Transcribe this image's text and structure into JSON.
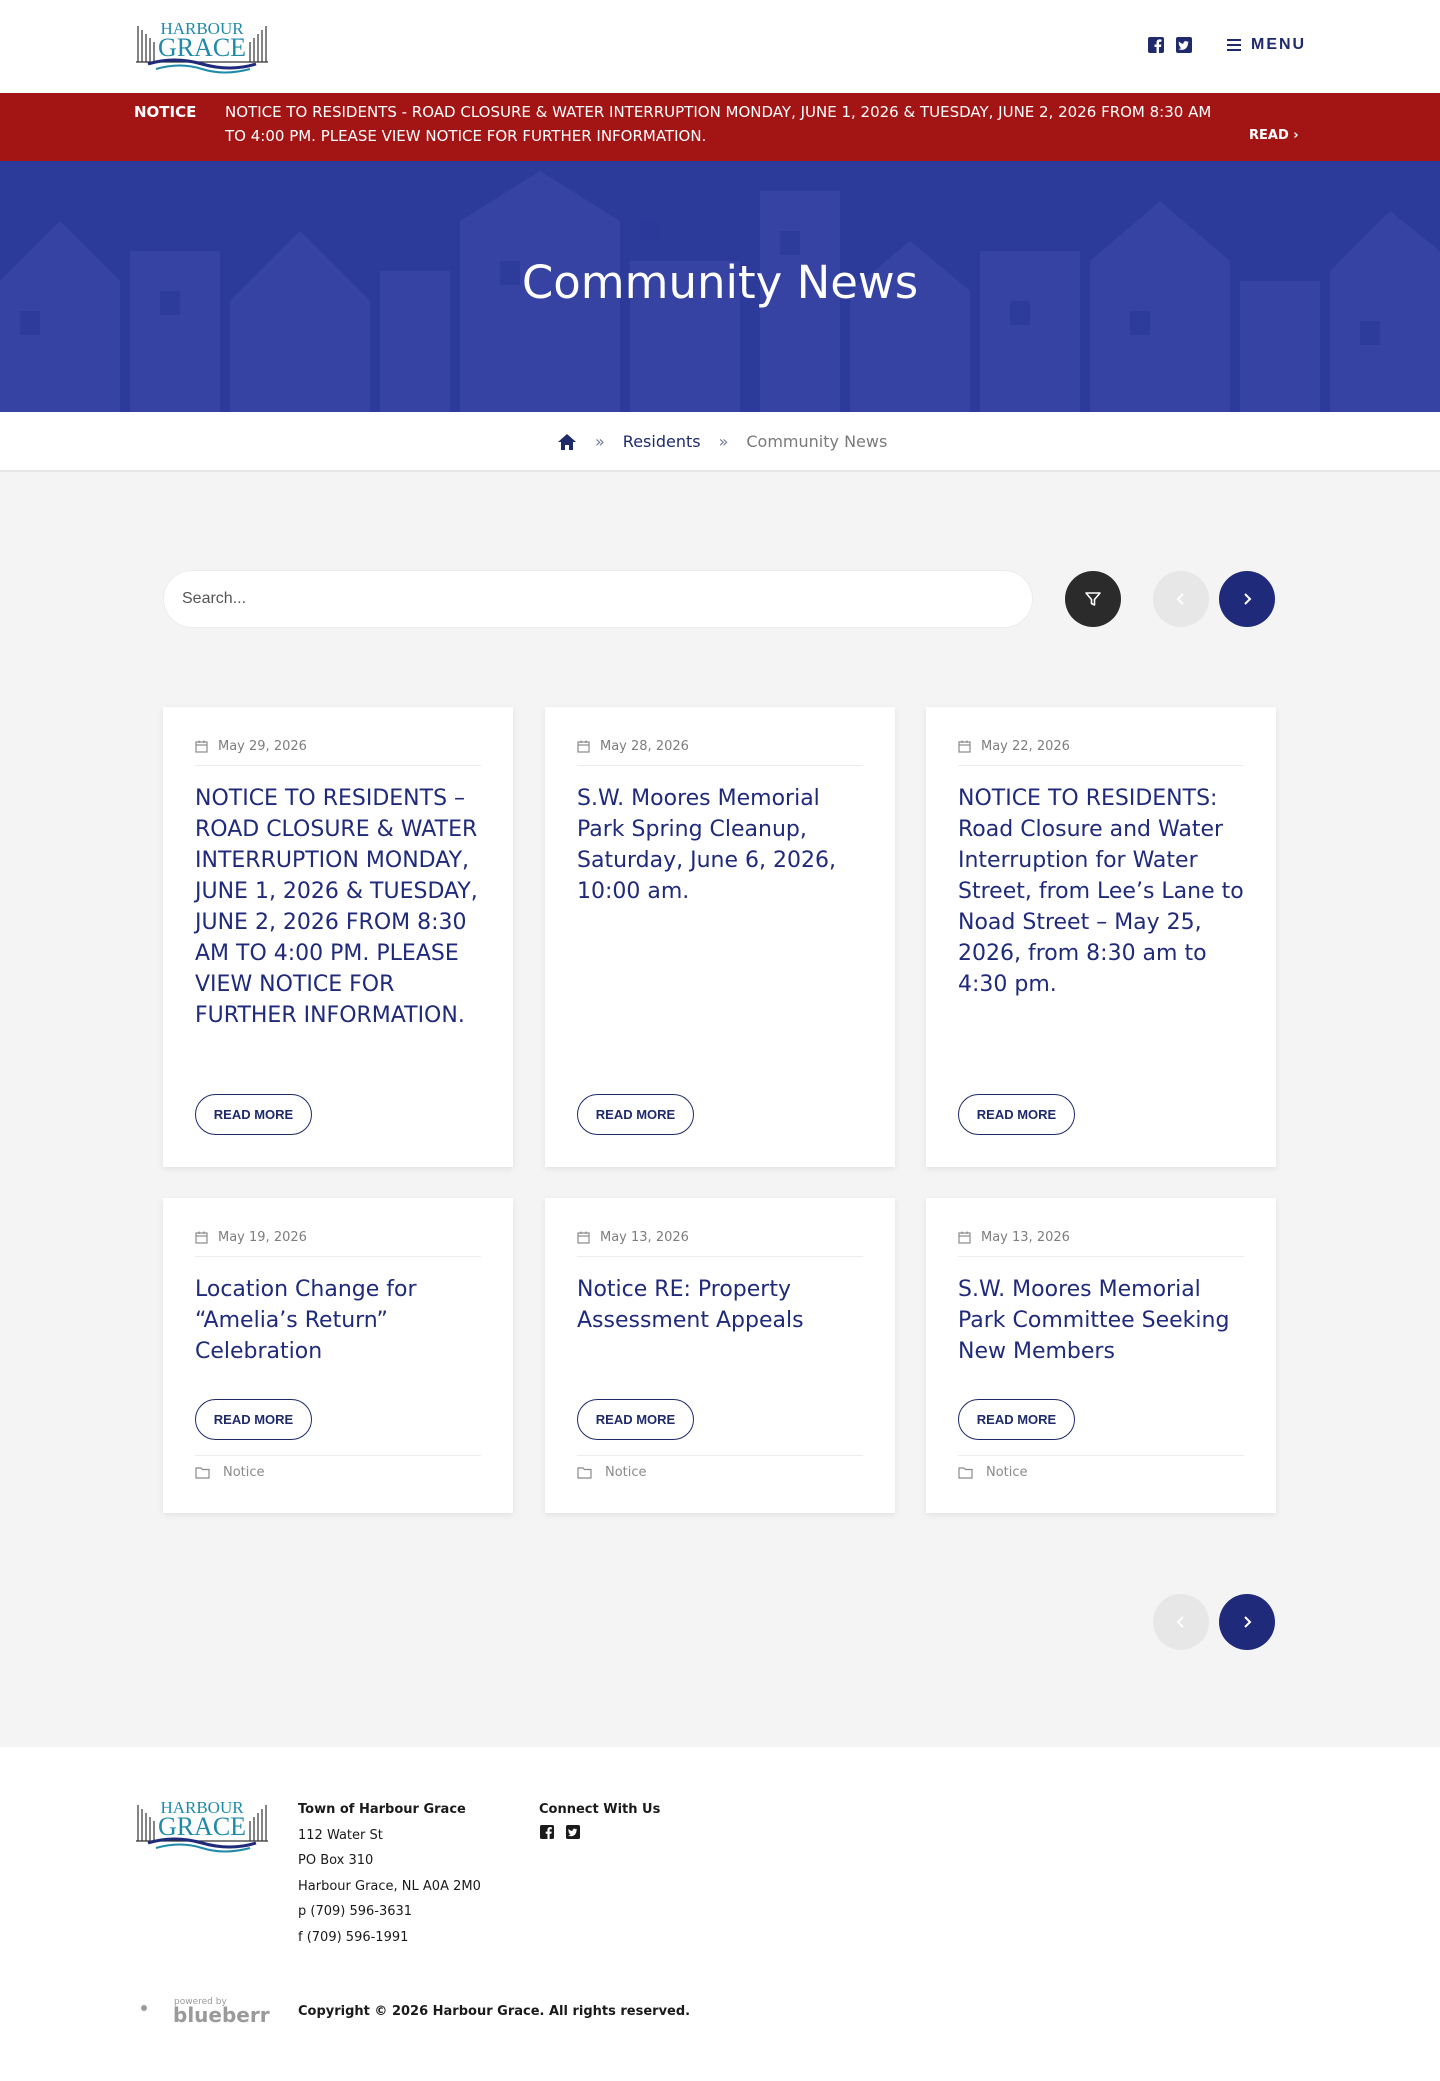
{
  "header": {
    "logo_top": "HARBOUR",
    "logo_bottom": "GRACE",
    "menu_label": "MENU"
  },
  "notice": {
    "label": "NOTICE",
    "text": "NOTICE TO RESIDENTS - ROAD CLOSURE & WATER INTERRUPTION MONDAY, JUNE 1, 2026 & TUESDAY, JUNE 2, 2026 FROM 8:30 AM TO 4:00 PM. PLEASE VIEW NOTICE FOR FURTHER INFORMATION.",
    "read_label": "READ"
  },
  "hero": {
    "title": "Community News"
  },
  "breadcrumb": {
    "sep": "»",
    "residents": "Residents",
    "current": "Community News"
  },
  "search": {
    "placeholder": "Search..."
  },
  "articles": [
    {
      "date": "May 29, 2026",
      "title": "NOTICE TO RESIDENTS – ROAD CLOSURE & WATER INTERRUPTION MONDAY, JUNE 1, 2026 & TUESDAY, JUNE 2, 2026 FROM 8:30 AM TO 4:00 PM. PLEASE VIEW NOTICE FOR FURTHER INFORMATION.",
      "read_more": "READ MORE"
    },
    {
      "date": "May 28, 2026",
      "title": "S.W. Moores Memorial Park Spring Cleanup, Saturday, June 6, 2026, 10:00 am.",
      "read_more": "READ MORE"
    },
    {
      "date": "May 22, 2026",
      "title": "NOTICE TO RESIDENTS: Road Closure and Water Interruption for Water Street, from Lee’s Lane to Noad Street – May 25, 2026, from 8:30 am to 4:30 pm.",
      "read_more": "READ MORE"
    },
    {
      "date": "May 19, 2026",
      "title": "Location Change for “Amelia’s Return” Celebration",
      "read_more": "READ MORE",
      "category": "Notice"
    },
    {
      "date": "May 13, 2026",
      "title": "Notice RE: Property Assessment Appeals",
      "read_more": "READ MORE",
      "category": "Notice"
    },
    {
      "date": "May 13, 2026",
      "title": "S.W. Moores Memorial Park Committee Seeking New Members",
      "read_more": "READ MORE",
      "category": "Notice"
    }
  ],
  "footer": {
    "org_title": "Town of Harbour Grace",
    "address1": "112 Water St",
    "address2": "PO Box 310",
    "address3": "Harbour Grace, NL A0A 2M0",
    "phone": "p (709) 596-3631",
    "fax": "f (709) 596-1991",
    "connect_title": "Connect With Us",
    "powered_small": "powered by",
    "powered_brand": "blueberry",
    "copyright": "Copyright © 2026 Harbour Grace. All rights reserved."
  },
  "colors": {
    "brand_navy": "#1f2a7a",
    "notice_red": "#a31515",
    "hero_blue": "#2c3a9a",
    "logo_teal": "#1f8aa8"
  },
  "icons": [
    "facebook-icon",
    "twitter-icon",
    "menu-icon",
    "home-icon",
    "filter-icon",
    "chevron-left-icon",
    "chevron-right-icon",
    "calendar-icon",
    "folder-icon"
  ]
}
